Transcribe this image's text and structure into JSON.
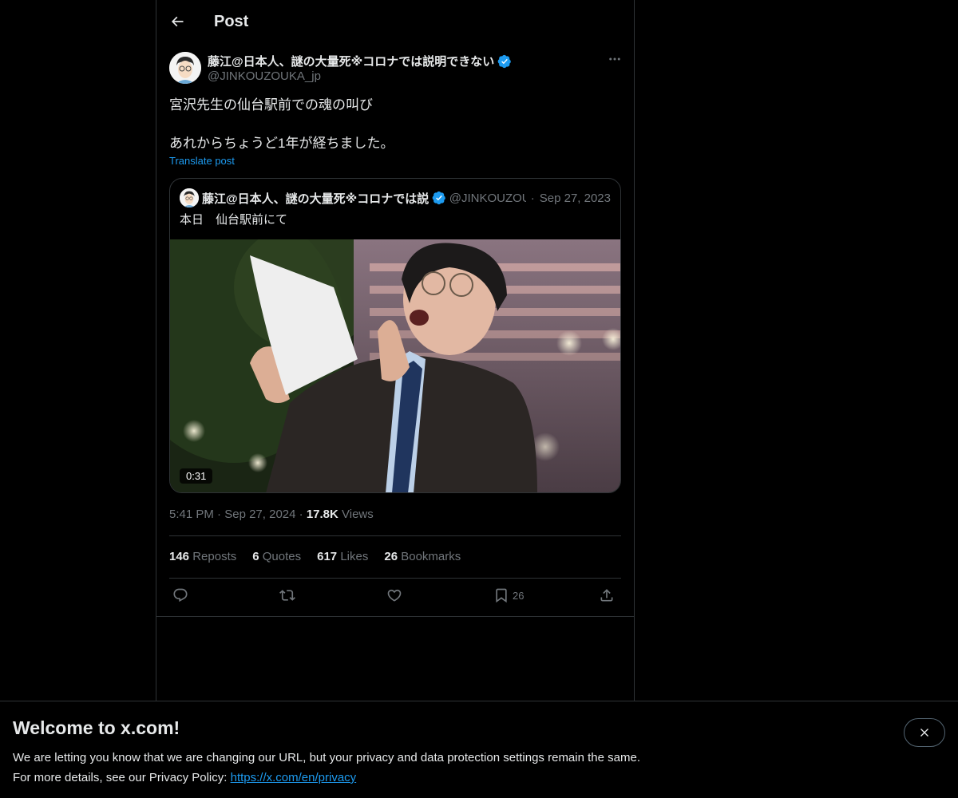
{
  "header": {
    "title": "Post"
  },
  "post": {
    "author_name": "藤江@日本人、謎の大量死※コロナでは説明できない",
    "author_handle": "@JINKOUZOUKA_jp",
    "text_line1": "宮沢先生の仙台駅前での魂の叫び",
    "text_line2": "あれからちょうど1年が経ちました。",
    "translate_label": "Translate post",
    "time": "5:41 PM",
    "date": "Sep 27, 2024",
    "views_count": "17.8K",
    "views_label": "Views"
  },
  "quote": {
    "author_name": "藤江@日本人、謎の大量死※コロナでは説明",
    "author_handle": "@JINKOUZOUKA_jp",
    "date": "Sep 27, 2023",
    "text": "本日　仙台駅前にて",
    "video_duration": "0:31"
  },
  "stats": {
    "reposts_count": "146",
    "reposts_label": "Reposts",
    "quotes_count": "6",
    "quotes_label": "Quotes",
    "likes_count": "617",
    "likes_label": "Likes",
    "bookmarks_count": "26",
    "bookmarks_label": "Bookmarks"
  },
  "actions": {
    "bookmark_count": "26"
  },
  "banner": {
    "title": "Welcome to x.com!",
    "line1": "We are letting you know that we are changing our URL, but your privacy and data protection settings remain the same.",
    "line2_prefix": "For more details, see our Privacy Policy:",
    "link_text": "https://x.com/en/privacy"
  },
  "colors": {
    "accent": "#1d9bf0",
    "background": "#000000",
    "text": "#e7e9ea",
    "muted": "#71767b",
    "border": "#2f3336"
  },
  "icons": [
    "back-arrow-icon",
    "verified-badge-icon",
    "more-icon",
    "reply-icon",
    "repost-icon",
    "like-icon",
    "bookmark-icon",
    "share-icon",
    "close-icon"
  ]
}
